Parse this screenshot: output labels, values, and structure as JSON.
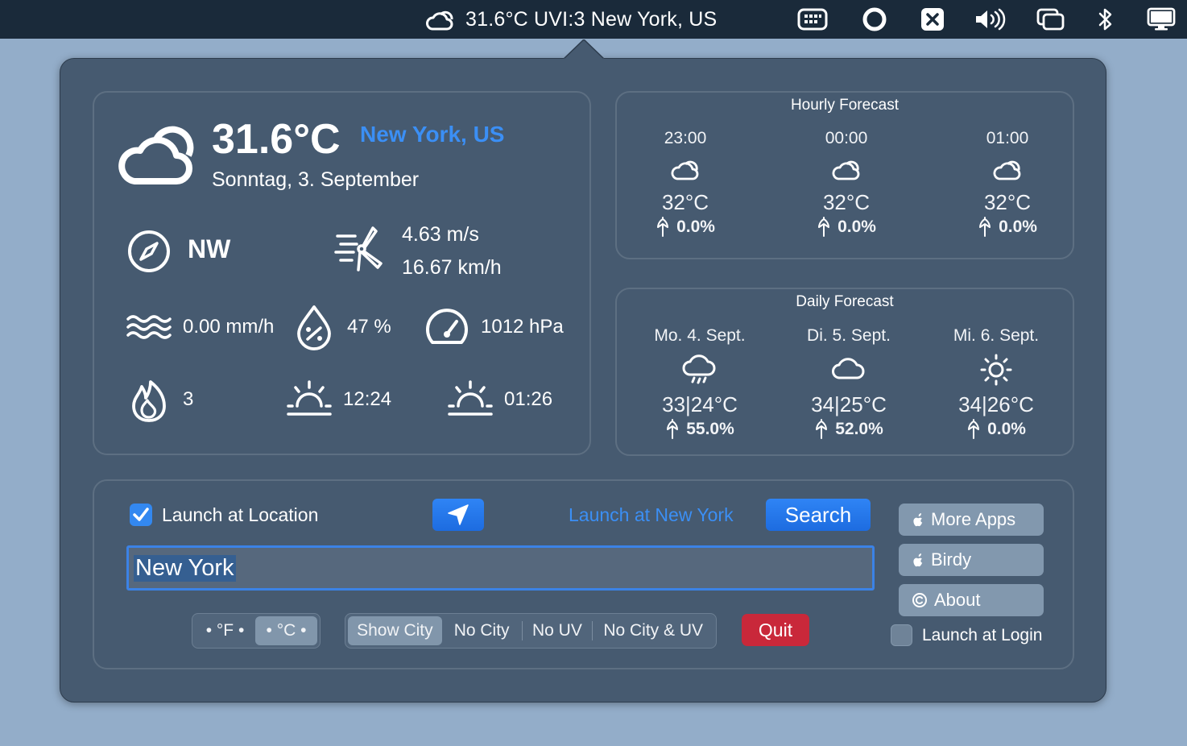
{
  "menubar": {
    "weather": "31.6°C  UVI:3  New York, US",
    "icons": [
      "cloud-icon",
      "mission-control-icon",
      "record-icon",
      "close-box-icon",
      "volume-icon",
      "screen-mirroring-icon",
      "bluetooth-icon",
      "display-icon"
    ]
  },
  "current": {
    "temp": "31.6°C",
    "city": "New York, US",
    "date": "Sonntag, 3. September",
    "wind_dir": "NW",
    "wind_ms": "4.63 m/s",
    "wind_kmh": "16.67 km/h",
    "rain": "0.00 mm/h",
    "humidity": "47 %",
    "pressure": "1012 hPa",
    "uv": "3",
    "sunrise": "12:24",
    "sunset": "01:26"
  },
  "hourly": {
    "title": "Hourly Forecast",
    "items": [
      {
        "time": "23:00",
        "temp": "32°C",
        "pop": "0.0%"
      },
      {
        "time": "00:00",
        "temp": "32°C",
        "pop": "0.0%"
      },
      {
        "time": "01:00",
        "temp": "32°C",
        "pop": "0.0%"
      }
    ]
  },
  "daily": {
    "title": "Daily Forecast",
    "items": [
      {
        "day": "Mo. 4. Sept.",
        "temp": "33|24°C",
        "pop": "55.0%",
        "icon": "rain-cloud-icon"
      },
      {
        "day": "Di. 5. Sept.",
        "temp": "34|25°C",
        "pop": "52.0%",
        "icon": "cloud-icon"
      },
      {
        "day": "Mi. 6. Sept.",
        "temp": "34|26°C",
        "pop": "0.0%",
        "icon": "sun-icon"
      }
    ]
  },
  "settings": {
    "launch_location_label": "Launch at Location",
    "launch_location_checked": true,
    "launch_city_label": "Launch at New York",
    "search_label": "Search",
    "city_value": "New York",
    "unit_f": "• °F •",
    "unit_c": "• °C •",
    "display_options": [
      "Show City",
      "No City",
      "No UV",
      "No City & UV"
    ],
    "quit_label": "Quit",
    "more_apps_label": "More Apps",
    "birdy_label": "Birdy",
    "about_label": "About",
    "launch_login_label": "Launch at Login",
    "launch_login_checked": false
  },
  "colors": {
    "accent": "#3388f0",
    "link": "#3b8ff5",
    "quit": "#c9283a",
    "popover": "#465a70"
  }
}
